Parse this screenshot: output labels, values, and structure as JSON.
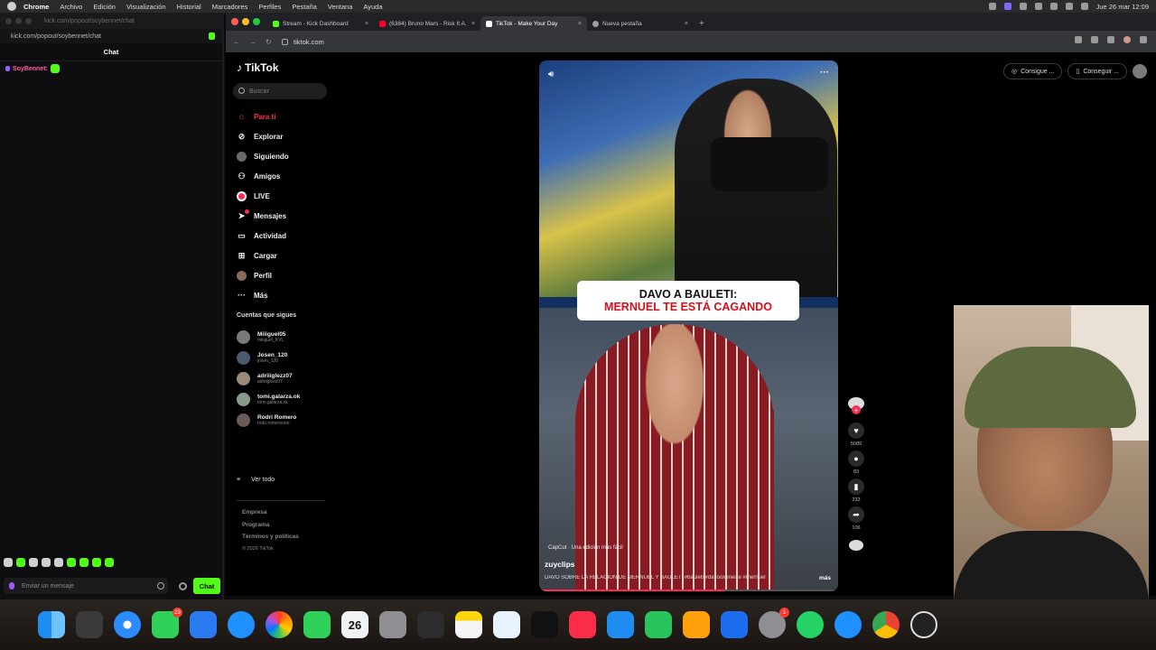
{
  "menubar": {
    "items": [
      "Chrome",
      "Archivo",
      "Edición",
      "Visualización",
      "Historial",
      "Marcadores",
      "Perfiles",
      "Pestaña",
      "Ventana",
      "Ayuda"
    ],
    "clock": "Jue 26 mar 12:09"
  },
  "popout": {
    "title": "kick.com/popout/soybennet/chat",
    "url": "kick.com/popout/soybennet/chat",
    "header": "Chat",
    "message_user": "SoyBennet:",
    "input_placeholder": "Enviar un mensaje",
    "chat_button": "Chat"
  },
  "tabs": [
    {
      "label": "Stream - Kick Dashboard",
      "color": "#53fc18"
    },
    {
      "label": "(6384) Bruno Mars - Risk It A...",
      "color": "#ff0033"
    },
    {
      "label": "TikTok - Make Your Day",
      "color": "#ffffff"
    },
    {
      "label": "Nueva pestaña",
      "color": "#9aa0a6"
    }
  ],
  "address": "tiktok.com",
  "tiktok": {
    "logo": "TikTok",
    "search_placeholder": "Buscar",
    "nav": [
      {
        "label": "Para ti",
        "icon": "home-icon"
      },
      {
        "label": "Explorar",
        "icon": "compass-icon"
      },
      {
        "label": "Siguiendo",
        "icon": "following-avatar-icon"
      },
      {
        "label": "Amigos",
        "icon": "friends-icon"
      },
      {
        "label": "LIVE",
        "icon": "live-icon"
      },
      {
        "label": "Mensajes",
        "icon": "messages-icon"
      },
      {
        "label": "Actividad",
        "icon": "activity-icon"
      },
      {
        "label": "Cargar",
        "icon": "upload-icon"
      },
      {
        "label": "Perfil",
        "icon": "profile-icon"
      },
      {
        "label": "Más",
        "icon": "more-icon"
      }
    ],
    "following_header": "Cuentas que sigues",
    "following": [
      {
        "name": "Miiiguel05",
        "handle": "miiiguel_KVL"
      },
      {
        "name": "Josen_120",
        "handle": "josen_120"
      },
      {
        "name": "adriiiglezz07",
        "handle": "adriiiglezz07"
      },
      {
        "name": "tomi.galarza.ok",
        "handle": "tomi.galarza.ok"
      },
      {
        "name": "Rodri Romero",
        "handle": "rodri.romeroooo"
      }
    ],
    "see_all": "Ver todo",
    "footer": [
      "Empresa",
      "Programa",
      "Términos y políticas"
    ],
    "copyright": "© 2026 TikTok",
    "pills": [
      "Consigue ...",
      "Conseguir ..."
    ]
  },
  "video": {
    "caption_line1": "DAVO A BAULETI:",
    "caption_line2": "MERNUEL TE ESTÁ CAGANDO",
    "capcut": "CapCut · Una edición más fácil",
    "username": "zuyclips",
    "description": "DAVO SOBRE LA RELACIÓN DE MERNUEL Y BAULETI #bauleti #davooxeneize #mernuel",
    "more": "más",
    "progress": 0.62
  },
  "actions": {
    "likes": "5089",
    "comments": "83",
    "saves": "233",
    "shares": "106"
  },
  "dock": {
    "messages_badge": "23",
    "calendar_day": "26",
    "settings_badge": "1"
  }
}
